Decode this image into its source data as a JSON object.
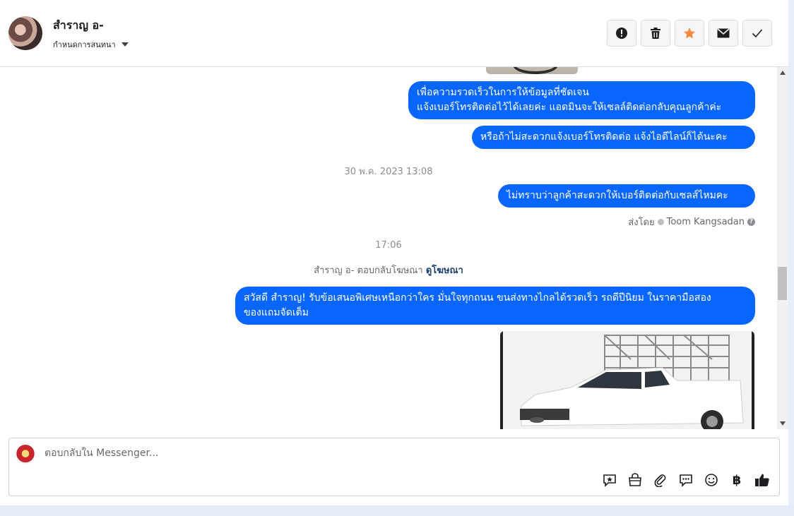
{
  "header": {
    "contact_name": "สำราญ อ-",
    "status_label": "กำหนดการสนทนา",
    "toolbar_icons": [
      "report-icon",
      "trash-icon",
      "star-icon",
      "mail-icon",
      "check-icon"
    ]
  },
  "messages": {
    "bubbles": [
      {
        "text": "เพื่อความรวดเร็วในการให้ข้อมูลที่ชัดเจน\nแจ้งเบอร์โทรติดต่อไว้ได้เลยค่ะ แอดมินจะให้เซลล์ติดต่อกลับคุณลูกค้าค่ะ"
      },
      {
        "text": "หรือถ้าไม่สะดวกแจ้งเบอร์โทรติดต่อ แจ้งไอดีไลน์ก็ได้นะคะ"
      },
      {
        "text": "ไม่ทราบว่าลูกค้าสะดวกให้เบอร์ติดต่อกับเซลส์ไหมคะ"
      },
      {
        "text": "สวัสดี สำราญ! รับข้อเสนอพิเศษเหนือกว่าใคร  มั่นใจทุกถนน ขนส่งทางไกลได้รวดเร็ว รถดีปีนิยม ในราคามือสอง\nของแถมจัดเต็ม"
      }
    ],
    "timestamp_1": "30 พ.ค. 2023 13:08",
    "timestamp_2": "17:06",
    "sent_by_label": "ส่งโดย",
    "sent_by_name": "Toom Kangsadan",
    "help_mark": "?",
    "ad_reply_text": "สำราญ อ- ตอบกลับโฆษณา",
    "ad_link": "ดูโฆษณา"
  },
  "composer": {
    "placeholder": "ตอบกลับใน Messenger...",
    "baht_symbol": "฿",
    "tools": [
      "saved-reply-icon",
      "shop-icon",
      "attach-icon",
      "chat-icon",
      "emoji-icon",
      "baht-icon",
      "like-icon"
    ]
  },
  "colors": {
    "bubble": "#0866ff",
    "star": "#f5893c"
  }
}
